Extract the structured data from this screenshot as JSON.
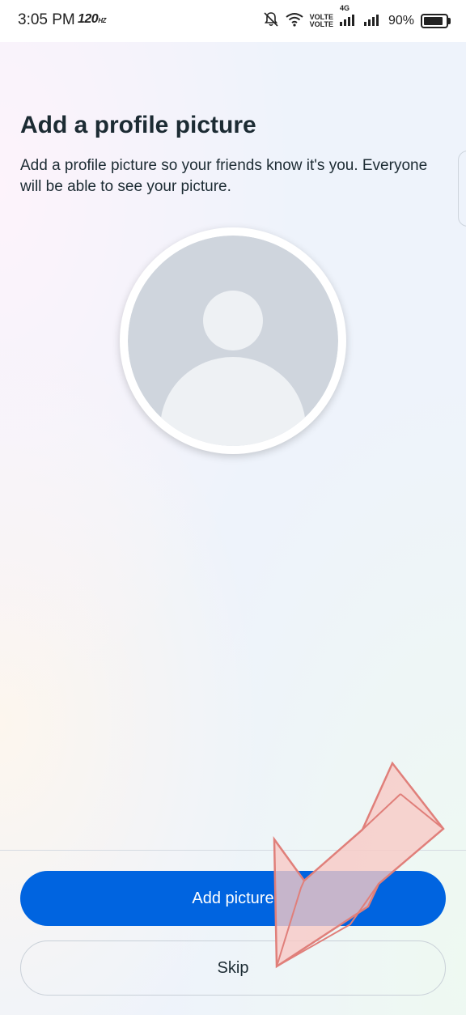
{
  "status_bar": {
    "time": "3:05 PM",
    "refresh_rate": "120",
    "refresh_unit": "HZ",
    "volte_1": "VOLTE",
    "volte_2": "VOLTE",
    "network_type": "4G",
    "battery_percent": "90%",
    "battery_level": 0.9
  },
  "page": {
    "title": "Add a profile picture",
    "description": "Add a profile picture so your friends know it's you. Everyone will be able to see your picture."
  },
  "actions": {
    "add_picture_label": "Add picture",
    "skip_label": "Skip"
  },
  "colors": {
    "primary_button": "#0064e0",
    "avatar_bg": "#cfd5dd",
    "avatar_figure": "#eef1f4",
    "arrow_fill": "#f8c9c6",
    "arrow_stroke": "#e07f7a"
  }
}
